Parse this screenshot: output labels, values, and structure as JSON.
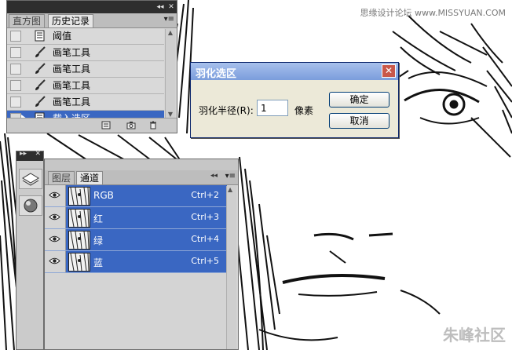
{
  "watermark_top": "思缘设计论坛 www.MISSYUAN.COM",
  "watermark_bottom": "朱峰社区",
  "history_panel": {
    "tabs": [
      "直方图",
      "历史记录"
    ],
    "active_tab": 1,
    "items": [
      {
        "label": "阈值",
        "icon": "adjustment-doc-icon",
        "selected": false
      },
      {
        "label": "画笔工具",
        "icon": "brush-icon",
        "selected": false
      },
      {
        "label": "画笔工具",
        "icon": "brush-icon",
        "selected": false
      },
      {
        "label": "画笔工具",
        "icon": "brush-icon",
        "selected": false
      },
      {
        "label": "画笔工具",
        "icon": "brush-icon",
        "selected": false
      },
      {
        "label": "载入选区",
        "icon": "load-selection-icon",
        "selected": true
      }
    ]
  },
  "channels_panel": {
    "tabs": [
      "图层",
      "通道"
    ],
    "active_tab": 1,
    "rows": [
      {
        "name": "RGB",
        "shortcut": "Ctrl+2"
      },
      {
        "name": "红",
        "shortcut": "Ctrl+3"
      },
      {
        "name": "绿",
        "shortcut": "Ctrl+4"
      },
      {
        "name": "蓝",
        "shortcut": "Ctrl+5"
      }
    ]
  },
  "dialog": {
    "title": "羽化选区",
    "field_label": "羽化半径(R):",
    "field_value": "1",
    "unit": "像素",
    "ok_label": "确定",
    "cancel_label": "取消"
  },
  "colors": {
    "selection_blue": "#3a67c2",
    "panel_gray": "#d4d4d4",
    "dialog_bg": "#ece9d8"
  }
}
